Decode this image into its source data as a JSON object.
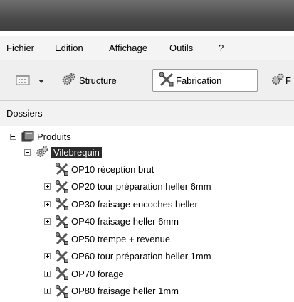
{
  "menu": {
    "fichier": "Fichier",
    "edition": "Edition",
    "affichage": "Affichage",
    "outils": "Outils",
    "help": "?"
  },
  "toolbar": {
    "structure_label": "Structure",
    "fabrication_label": "Fabrication",
    "partial_label": "F"
  },
  "panel": {
    "title": "Dossiers"
  },
  "tree": {
    "root": "Produits",
    "child": "Vilebrequin",
    "ops": [
      "OP10 réception brut",
      "OP20 tour préparation heller 6mm",
      "OP30 fraisage encoches heller",
      "OP40 fraisage heller 6mm",
      "OP50 trempe + revenue",
      "OP60 tour préparation heller 1mm",
      "OP70 forage",
      "OP80 fraisage heller 1mm"
    ]
  }
}
